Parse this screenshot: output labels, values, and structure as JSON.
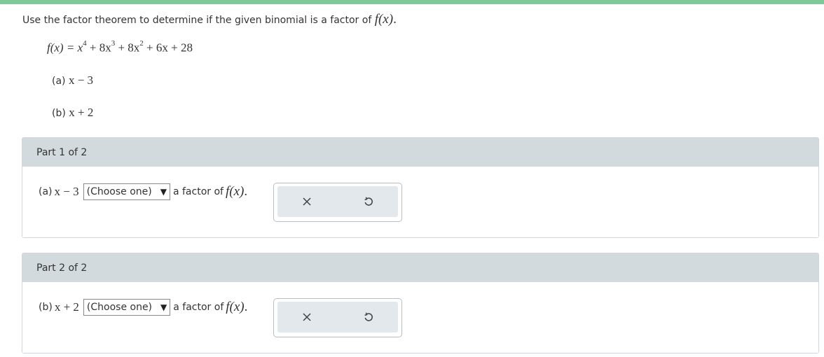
{
  "prompt": {
    "text": "Use the factor theorem to determine if the given binomial is a factor of ",
    "fx": "f(x)",
    "period": "."
  },
  "equation": {
    "lhs": "f(x) = ",
    "t1": "x",
    "t1_exp": "4",
    "t2": " + 8x",
    "t2_exp": "3",
    "t3": " + 8x",
    "t3_exp": "2",
    "t4": " + 6x + 28"
  },
  "items": [
    {
      "label": "(a)",
      "expr": "x − 3"
    },
    {
      "label": "(b)",
      "expr": "x + 2"
    }
  ],
  "parts": [
    {
      "title": "Part 1 of 2",
      "label": "(a)",
      "expr": "x − 3",
      "select": "(Choose one)",
      "suffix": "a factor of",
      "fx": "f(x)",
      "period": "."
    },
    {
      "title": "Part 2 of 2",
      "label": "(b)",
      "expr": "x + 2",
      "select": "(Choose one)",
      "suffix": "a factor of",
      "fx": "f(x)",
      "period": "."
    }
  ],
  "icons": {
    "clear": "close-icon",
    "reset": "undo-icon"
  },
  "colors": {
    "accent_bar": "#7ec99a",
    "part_header": "#d3dadd",
    "action_panel": "#e2e8eb"
  }
}
